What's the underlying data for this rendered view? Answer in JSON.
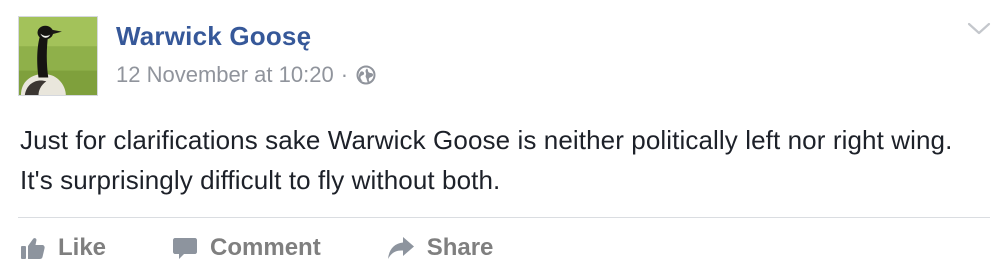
{
  "post": {
    "author": "Warwick Goosę",
    "timestamp": "12 November at 10:20",
    "separator": "·",
    "privacy_icon": "globe-icon",
    "avatar_icon": "goose-avatar",
    "menu_icon": "chevron-down-icon",
    "message": "Just for clarifications sake Warwick Goose is neither politically left nor right wing. It's surprisingly difficult to fly without both."
  },
  "actions": {
    "like_label": "Like",
    "comment_label": "Comment",
    "share_label": "Share",
    "like_icon": "thumbs-up-icon",
    "comment_icon": "comment-icon",
    "share_icon": "share-icon"
  },
  "colors": {
    "author": "#365899",
    "meta": "#90949c",
    "text": "#1d2129",
    "action": "#7f7f7f",
    "divider": "#dadde1"
  }
}
